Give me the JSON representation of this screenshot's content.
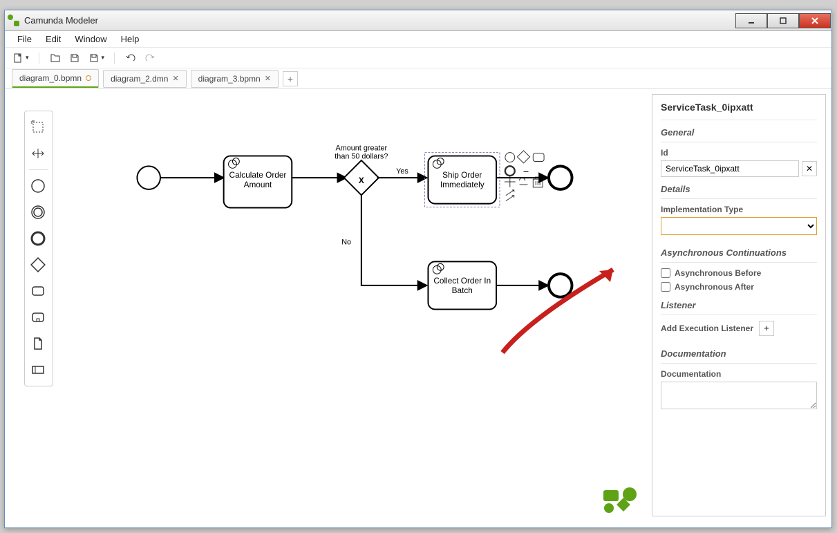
{
  "window": {
    "title": "Camunda Modeler"
  },
  "menu": {
    "file": "File",
    "edit": "Edit",
    "window": "Window",
    "help": "Help"
  },
  "tabs": [
    {
      "label": "diagram_0.bpmn",
      "active": true,
      "dirty": true
    },
    {
      "label": "diagram_2.dmn",
      "active": false
    },
    {
      "label": "diagram_3.bpmn",
      "active": false
    }
  ],
  "diagram": {
    "task1": "Calculate Order\nAmount",
    "task2": "Ship Order\nImmediately",
    "task3": "Collect Order In\nBatch",
    "gateway_label": "Amount greater\nthan 50 dollars?",
    "yes": "Yes",
    "no": "No"
  },
  "panel": {
    "title": "ServiceTask_0ipxatt",
    "general": "General",
    "id_label": "Id",
    "id_value": "ServiceTask_0ipxatt",
    "details": "Details",
    "impl_type": "Implementation Type",
    "async": "Asynchronous Continuations",
    "async_before": "Asynchronous Before",
    "async_after": "Asynchronous After",
    "listener": "Listener",
    "add_listener": "Add Execution Listener",
    "documentation_section": "Documentation",
    "documentation_label": "Documentation"
  }
}
